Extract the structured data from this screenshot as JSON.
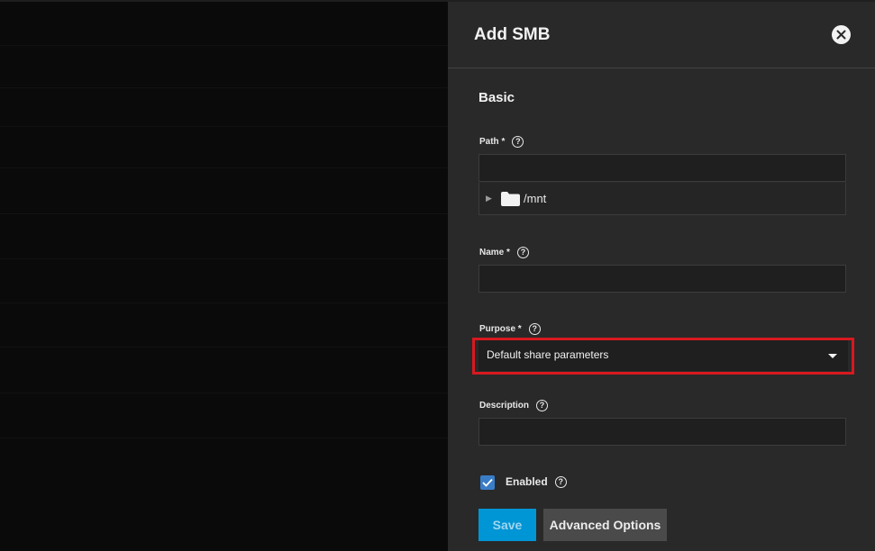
{
  "panel": {
    "title": "Add SMB",
    "section": "Basic"
  },
  "fields": {
    "path": {
      "label": "Path",
      "required_mark": "*",
      "value": ""
    },
    "tree": {
      "root_label": "/mnt"
    },
    "name": {
      "label": "Name",
      "required_mark": "*",
      "value": ""
    },
    "purpose": {
      "label": "Purpose",
      "required_mark": "*",
      "selected": "Default share parameters"
    },
    "description": {
      "label": "Description",
      "value": ""
    },
    "enabled": {
      "label": "Enabled",
      "checked": true
    }
  },
  "help_glyph": "?",
  "buttons": {
    "save": "Save",
    "advanced": "Advanced Options"
  },
  "colors": {
    "panel_bg": "#292929",
    "input_bg": "#1f1f1f",
    "accent": "#0095d5",
    "highlight": "#d7191f",
    "checkbox": "#3a7dc7"
  },
  "icons": [
    "close-icon",
    "help-icon",
    "folder-icon",
    "expand-arrow-icon",
    "chevron-down-icon",
    "checkmark-icon"
  ]
}
